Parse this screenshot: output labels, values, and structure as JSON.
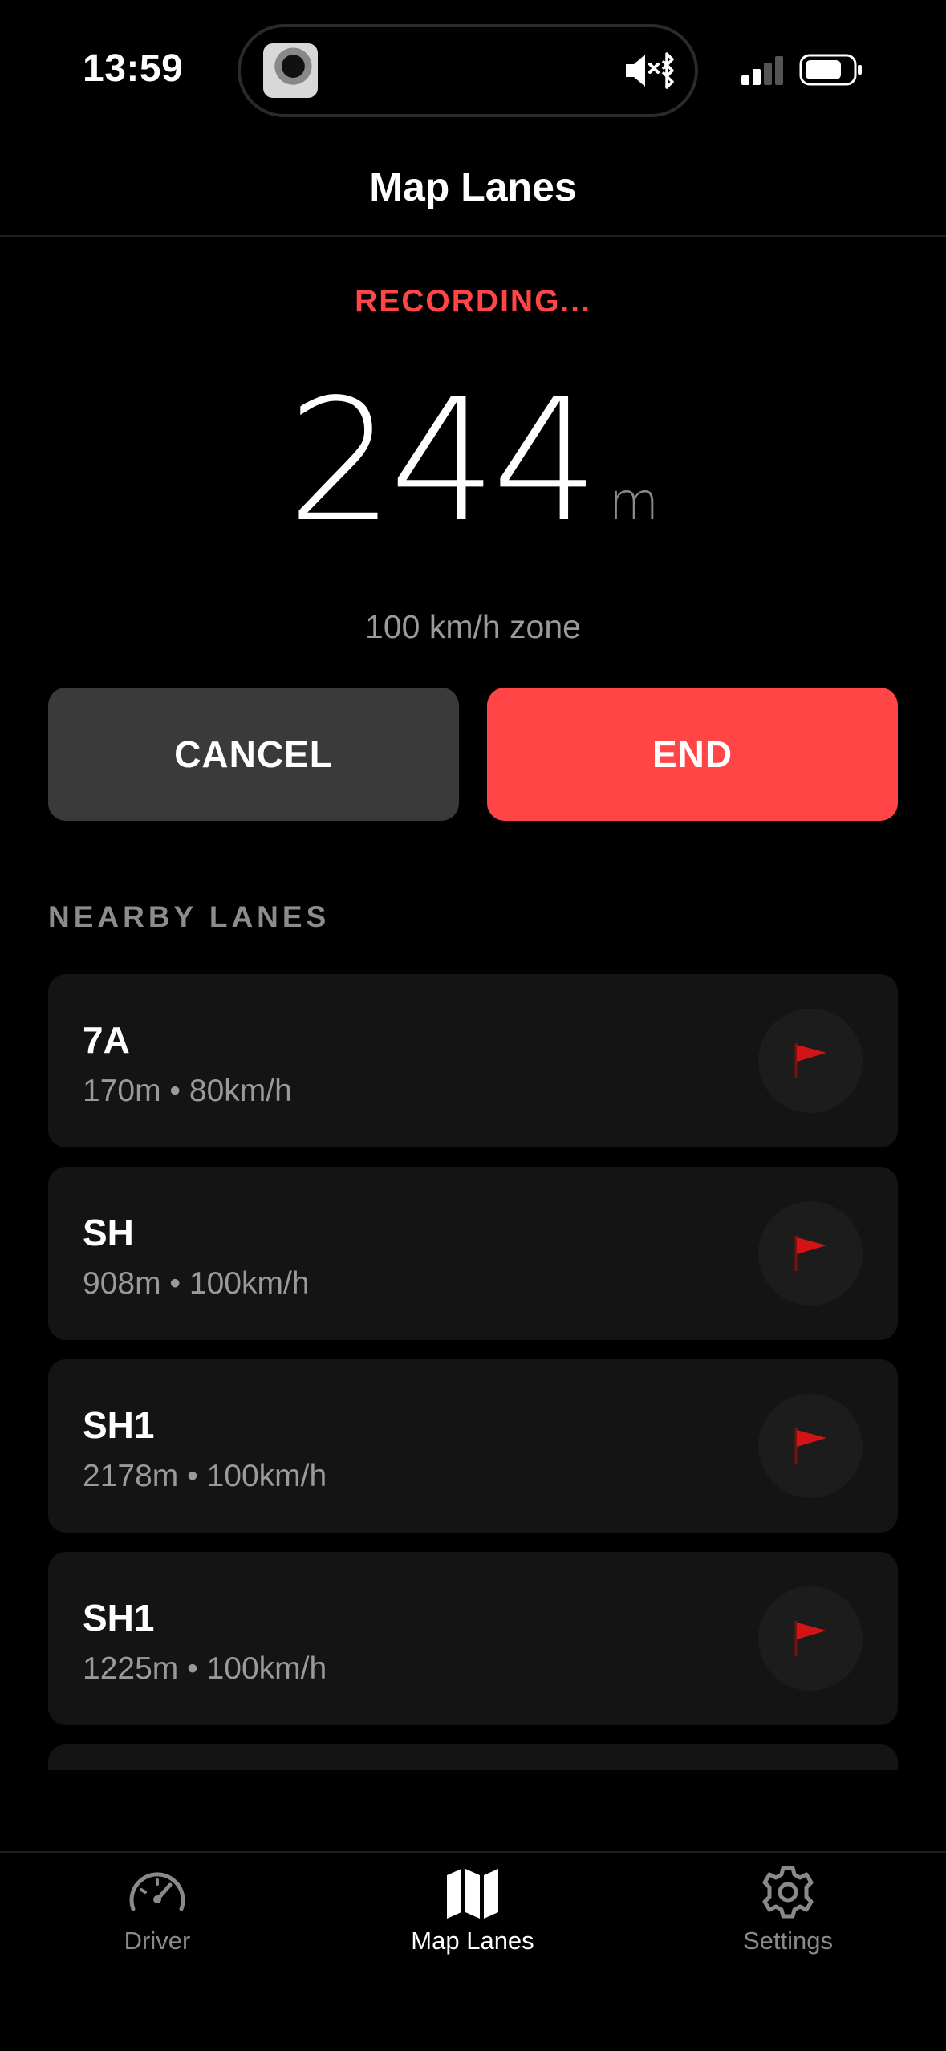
{
  "status_bar": {
    "time": "13:59",
    "island_icon": "mute-bluetooth-icon",
    "signal_icon": "cellular-signal-icon",
    "battery_icon": "battery-icon"
  },
  "header": {
    "title": "Map Lanes"
  },
  "recording": {
    "status": "RECORDING...",
    "distance": "244",
    "unit": "m",
    "zone": "100 km/h zone",
    "status_color": "#ff4545"
  },
  "actions": {
    "cancel_label": "CANCEL",
    "end_label": "END"
  },
  "nearby": {
    "title": "NEARBY LANES",
    "lanes": [
      {
        "name": "7A",
        "meta": "170m • 80km/h"
      },
      {
        "name": "SH",
        "meta": "908m • 100km/h"
      },
      {
        "name": "SH1",
        "meta": "2178m • 100km/h"
      },
      {
        "name": "SH1",
        "meta": "1225m • 100km/h"
      }
    ],
    "flag_icon": "red-flag-icon"
  },
  "tabs": [
    {
      "label": "Driver",
      "icon": "speedometer-icon",
      "active": false
    },
    {
      "label": "Map Lanes",
      "icon": "map-icon",
      "active": true
    },
    {
      "label": "Settings",
      "icon": "gear-icon",
      "active": false
    }
  ]
}
